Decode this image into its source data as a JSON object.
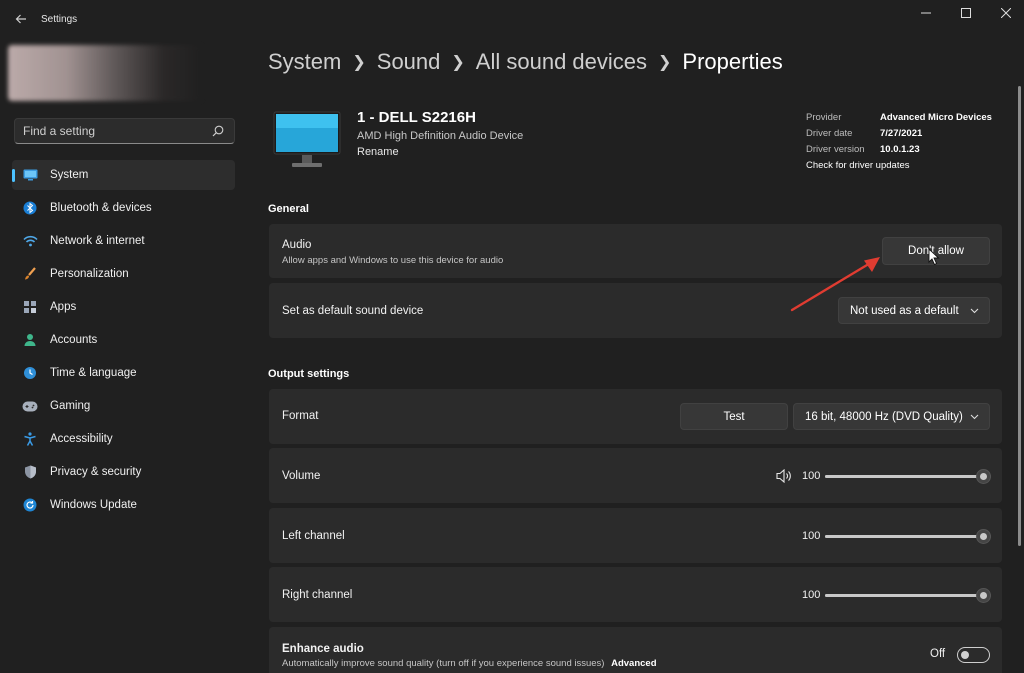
{
  "window": {
    "title": "Settings",
    "back_icon": "arrow-left-icon"
  },
  "sidebar": {
    "search": {
      "placeholder": "Find a setting"
    },
    "items": [
      {
        "label": "System",
        "icon": "monitor-icon",
        "active": true
      },
      {
        "label": "Bluetooth & devices",
        "icon": "bluetooth-icon"
      },
      {
        "label": "Network & internet",
        "icon": "wifi-icon"
      },
      {
        "label": "Personalization",
        "icon": "brush-icon"
      },
      {
        "label": "Apps",
        "icon": "apps-icon"
      },
      {
        "label": "Accounts",
        "icon": "person-icon"
      },
      {
        "label": "Time & language",
        "icon": "globe-clock-icon"
      },
      {
        "label": "Gaming",
        "icon": "gamepad-icon"
      },
      {
        "label": "Accessibility",
        "icon": "accessibility-icon"
      },
      {
        "label": "Privacy & security",
        "icon": "shield-icon"
      },
      {
        "label": "Windows Update",
        "icon": "update-icon"
      }
    ]
  },
  "breadcrumb": [
    "System",
    "Sound",
    "All sound devices",
    "Properties"
  ],
  "device": {
    "name": "1 - DELL S2216H",
    "description": "AMD High Definition Audio Device",
    "rename": "Rename"
  },
  "driver": {
    "provider_label": "Provider",
    "provider": "Advanced Micro Devices",
    "date_label": "Driver date",
    "date": "7/27/2021",
    "version_label": "Driver version",
    "version": "10.0.1.23",
    "check_link": "Check for driver updates"
  },
  "general": {
    "title": "General",
    "audio": {
      "title": "Audio",
      "subtitle": "Allow apps and Windows to use this device for audio",
      "button": "Don't allow"
    },
    "default": {
      "title": "Set as default sound device",
      "value": "Not used as a default"
    }
  },
  "output": {
    "title": "Output settings",
    "format": {
      "title": "Format",
      "test_button": "Test",
      "value": "16 bit, 48000 Hz (DVD Quality)"
    },
    "volume": {
      "title": "Volume",
      "value": "100",
      "level": 1.0
    },
    "left": {
      "title": "Left channel",
      "value": "100",
      "level": 1.0
    },
    "right": {
      "title": "Right channel",
      "value": "100",
      "level": 1.0
    },
    "enhance": {
      "title": "Enhance audio",
      "subtitle": "Automatically improve sound quality (turn off if you experience sound issues)",
      "link": "Advanced",
      "state": "Off"
    }
  },
  "colors": {
    "accent": "#4cc2ff",
    "background": "#202020",
    "card": "#2b2b2b",
    "arrow": "#e03c31"
  }
}
